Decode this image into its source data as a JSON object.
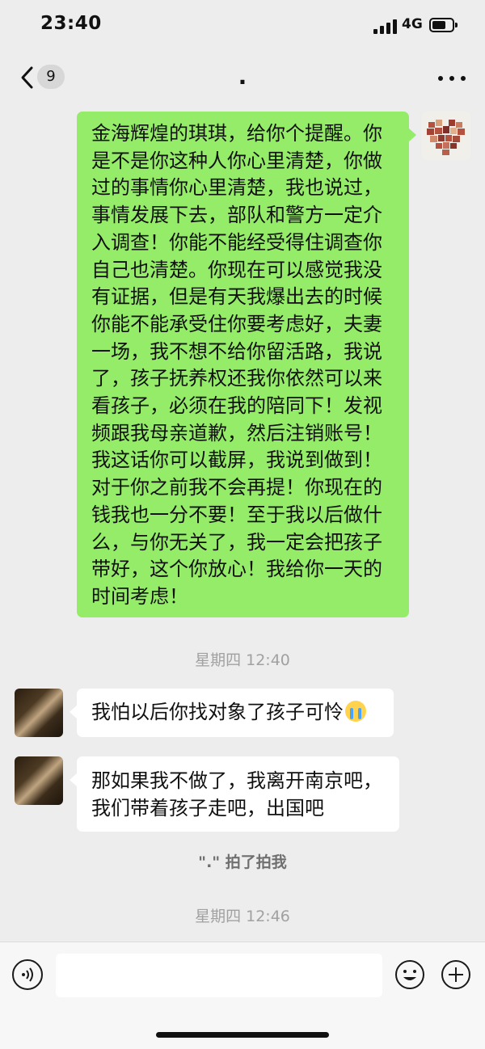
{
  "status_bar": {
    "time": "23:40",
    "network": "4G"
  },
  "nav": {
    "unread_count": "9",
    "title": "."
  },
  "messages": [
    {
      "sender": "self",
      "lines": [
        "金海辉煌的琪琪，给你个提醒。你",
        "是不是你这种人你心里清楚，你做",
        "过的事情你心里清楚，我也说过，",
        "事情发展下去，部队和警方一定介",
        "入调查！你能不能经受得住调查你",
        "自己也清楚。你现在可以感觉我没",
        "有证据，但是有天我爆出去的时候",
        "你能不能承受住你要考虑好，夫妻",
        "一场，我不想不给你留活路，我说",
        "了，孩子抚养权还我你依然可以来",
        "看孩子，必须在我的陪同下！发视",
        "频跟我母亲道歉，然后注销账号！",
        "我这话你可以截屏，我说到做到！",
        "对于你之前我不会再提！你现在的",
        "钱我也一分不要！至于我以后做什",
        "么，与你无关了，我一定会把孩子",
        "带好，这个你放心！我给你一天的",
        "时间考虑！"
      ]
    },
    {
      "sender": "other",
      "lines": [
        "我怕以后你找对象了孩子可怜"
      ],
      "emoji": "crying-face"
    },
    {
      "sender": "other",
      "lines": [
        "那如果我不做了，我离开南京吧，",
        "我们带着孩子走吧，出国吧"
      ]
    }
  ],
  "timestamps": [
    "星期四 12:40",
    "星期四 12:46"
  ],
  "system_notice": "\".\" 拍了拍我",
  "input": {
    "placeholder": ""
  }
}
